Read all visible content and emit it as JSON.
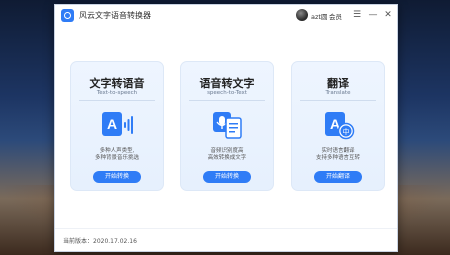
{
  "window": {
    "title": "风云文字语音转换器",
    "user_name": "azt圆",
    "status_label": "会员",
    "menu_icon": "menu-icon",
    "minimize_icon": "minimize-icon",
    "close_icon": "close-icon"
  },
  "cards": [
    {
      "title": "文字转语音",
      "subtitle": "Text-to-speech",
      "icon": "text-to-speech-icon",
      "desc_line1": "多种人声类型,",
      "desc_line2": "多种背景音乐挑选",
      "button": "开始转换"
    },
    {
      "title": "语音转文字",
      "subtitle": "speech-to-Text",
      "icon": "speech-to-text-icon",
      "desc_line1": "音频识别度高",
      "desc_line2": "高效转换成文字",
      "button": "开始转换"
    },
    {
      "title": "翻译",
      "subtitle": "Translate",
      "icon": "translate-icon",
      "desc_line1": "实时语言翻译",
      "desc_line2": "支持多种语言互转",
      "button": "开始翻译"
    }
  ],
  "footer": {
    "version": "当前版本：2020.17.02.16"
  },
  "colors": {
    "accent": "#2f7cf6",
    "card_bg": "#eef5ff"
  }
}
